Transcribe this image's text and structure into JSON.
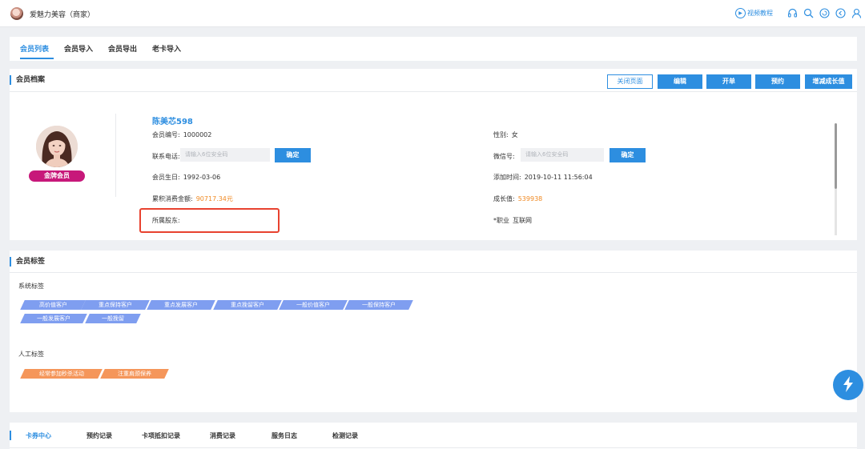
{
  "header": {
    "shop_name": "爱魅力美容（商家）",
    "video_guide": "视频教程",
    "icons": [
      "headset-icon",
      "search-icon",
      "refresh-icon",
      "back-icon",
      "user-icon"
    ]
  },
  "tabs": [
    {
      "label": "会员列表",
      "active": true
    },
    {
      "label": "会员导入",
      "active": false
    },
    {
      "label": "会员导出",
      "active": false
    },
    {
      "label": "老卡导入",
      "active": false
    }
  ],
  "archive": {
    "title": "会员档案",
    "buttons": {
      "close_page": "关闭页面",
      "edit": "编辑",
      "open_order": "开单",
      "reserve": "预约",
      "adjust_growth": "增减成长值"
    },
    "member": {
      "name": "陈美芯598",
      "badge": "金牌会员",
      "member_no_label": "会员编号:",
      "member_no": "1000002",
      "gender_label": "性别:",
      "gender": "女",
      "phone_label": "联系电话:",
      "phone_placeholder": "请输入6位安全码",
      "phone_confirm": "确定",
      "wechat_label": "微信号:",
      "wechat_placeholder": "请输入6位安全码",
      "wechat_confirm": "确定",
      "birthday_label": "会员生日:",
      "birthday": "1992-03-06",
      "added_label": "添加时间:",
      "added": "2019-10-11 11:56:04",
      "total_spend_label": "累积消费金额:",
      "total_spend": "90717.34元",
      "growth_label": "成长值:",
      "growth": "539938",
      "shareholder_label": "所属股东:",
      "job_label": "*职业",
      "job": "互联网"
    }
  },
  "member_tags": {
    "title": "会员标签",
    "system_label": "系统标签",
    "system_tags": [
      "高价值客户",
      "重点保持客户",
      "重点发展客户",
      "重点挽留客户",
      "一般价值客户",
      "一般保持客户",
      "一般发展客户",
      "一般挽留"
    ],
    "manual_label": "人工标签",
    "manual_tags": [
      "经常参加秒杀活动",
      "注重肩颈保养"
    ]
  },
  "bottom_tabs": [
    {
      "label": "卡券中心",
      "active": true
    },
    {
      "label": "预约记录",
      "active": false
    },
    {
      "label": "卡项抵扣记录",
      "active": false
    },
    {
      "label": "消费记录",
      "active": false
    },
    {
      "label": "服务日志",
      "active": false
    },
    {
      "label": "检测记录",
      "active": false
    }
  ],
  "colors": {
    "accent": "#2d8ee0",
    "badge": "#c7187a",
    "highlight": "#e8422f",
    "value_orange": "#f08a24",
    "system_tag": "#7f9ef0",
    "manual_tag": "#f5965a"
  }
}
